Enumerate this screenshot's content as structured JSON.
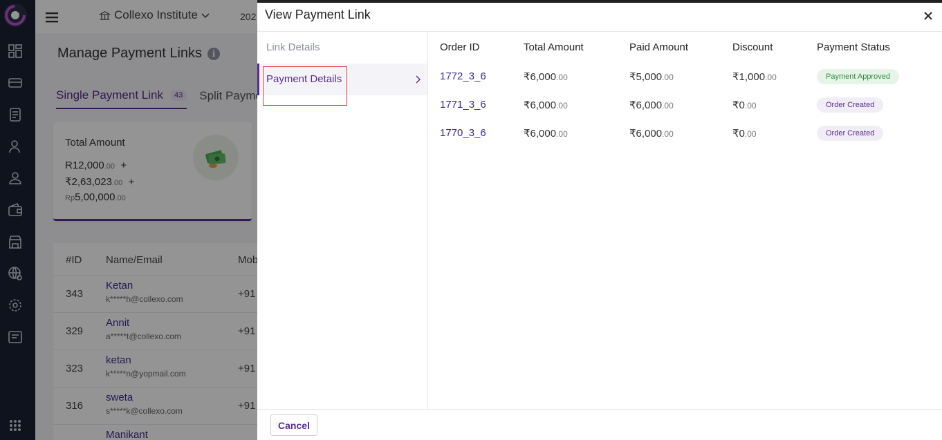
{
  "app": {
    "institute": "Collexo Institute",
    "year_prefix": "202",
    "page_title": "Manage Payment Links",
    "tabs": [
      {
        "label": "Single Payment Link",
        "count": "43"
      },
      {
        "label": "Split Payme"
      }
    ],
    "summary_card": {
      "title": "Total Amount",
      "amounts": [
        {
          "symbol": "R",
          "value": "12,000",
          "decimals": ".00",
          "plus": "+"
        },
        {
          "symbol": "₹",
          "value": "2,63,023",
          "decimals": ".00",
          "plus": "+"
        },
        {
          "symbol": "Rp",
          "value": "5,00,000",
          "decimals": ".00",
          "plus": ""
        }
      ]
    },
    "table": {
      "headers": {
        "id": "#ID",
        "name": "Name/Email",
        "mobile": "Mob"
      },
      "rows": [
        {
          "id": "343",
          "name": "Ketan",
          "email": "k*****h@collexo.com",
          "mobile": "+91"
        },
        {
          "id": "329",
          "name": "Annit",
          "email": "a*****t@collexo.com",
          "mobile": "+91"
        },
        {
          "id": "323",
          "name": "ketan",
          "email": "k*****n@yopmail.com",
          "mobile": "+91"
        },
        {
          "id": "316",
          "name": "sweta",
          "email": "s*****k@collexo.com",
          "mobile": "+91"
        },
        {
          "id": "",
          "name": "Manikant",
          "email": "",
          "mobile": ""
        }
      ]
    }
  },
  "drawer": {
    "title": "View Payment Link",
    "sidebar": {
      "link_details": "Link Details",
      "payment_details": "Payment Details"
    },
    "columns": {
      "order_id": "Order ID",
      "total_amount": "Total Amount",
      "paid_amount": "Paid Amount",
      "discount": "Discount",
      "payment_status": "Payment Status"
    },
    "rows": [
      {
        "order_id": "1772_3_6",
        "total": "₹6,000",
        "total_dec": ".00",
        "paid": "₹5,000",
        "paid_dec": ".00",
        "discount": "₹1,000",
        "discount_dec": ".00",
        "status": "Payment Approved",
        "status_kind": "ok"
      },
      {
        "order_id": "1771_3_6",
        "total": "₹6,000",
        "total_dec": ".00",
        "paid": "₹6,000",
        "paid_dec": ".00",
        "discount": "₹0",
        "discount_dec": ".00",
        "status": "Order Created",
        "status_kind": "created"
      },
      {
        "order_id": "1770_3_6",
        "total": "₹6,000",
        "total_dec": ".00",
        "paid": "₹6,000",
        "paid_dec": ".00",
        "discount": "₹0",
        "discount_dec": ".00",
        "status": "Order Created",
        "status_kind": "created"
      }
    ],
    "cancel_label": "Cancel"
  },
  "colors": {
    "brand": "#5b2a8c",
    "rail": "#1b2233",
    "approved_bg": "#e6f5e8",
    "approved_text": "#2e8b3d",
    "created_bg": "#f1edf7",
    "highlight_box": "#e23b3b"
  },
  "icons": [
    "logo-icon",
    "dashboard-icon",
    "card-icon",
    "receipt-icon",
    "user-icon",
    "admin-icon",
    "wallet-icon",
    "store-icon",
    "globe-icon",
    "settings-icon",
    "report-icon",
    "apps-grid-icon",
    "hamburger-icon",
    "institute-icon",
    "close-icon",
    "chevron-right-icon",
    "info-icon",
    "money-icon"
  ]
}
